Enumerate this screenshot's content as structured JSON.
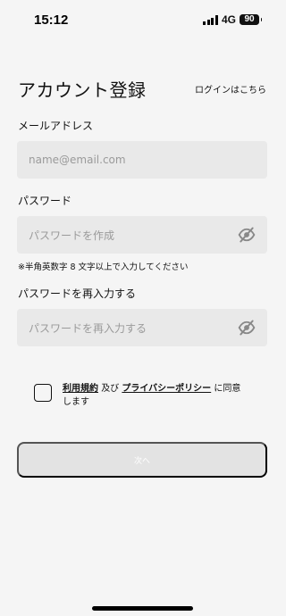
{
  "status_bar": {
    "time": "15:12",
    "network": "4G",
    "battery": "90"
  },
  "header": {
    "title": "アカウント登録",
    "login_link": "ログインはこちら"
  },
  "form": {
    "email": {
      "label": "メールアドレス",
      "placeholder": "name@email.com"
    },
    "password": {
      "label": "パスワード",
      "placeholder": "パスワードを作成",
      "hint": "※半角英数字 8 文字以上で入力してください",
      "visibility_icon": "eye-slash-icon"
    },
    "password_confirm": {
      "label": "パスワードを再入力する",
      "placeholder": "パスワードを再入力する",
      "visibility_icon": "eye-slash-icon"
    }
  },
  "agreement": {
    "checked": false,
    "terms_link": "利用規約",
    "conjunction": "及び",
    "privacy_link": "プライバシーポリシー",
    "suffix": "に同意します"
  },
  "next_button": {
    "label": "次へ",
    "enabled": false
  },
  "colors": {
    "background": "#f5f5f5",
    "input_background": "#e9e9e9",
    "disabled_button": "#e3e3e3",
    "text": "#111111",
    "placeholder": "#9a9a9a"
  }
}
